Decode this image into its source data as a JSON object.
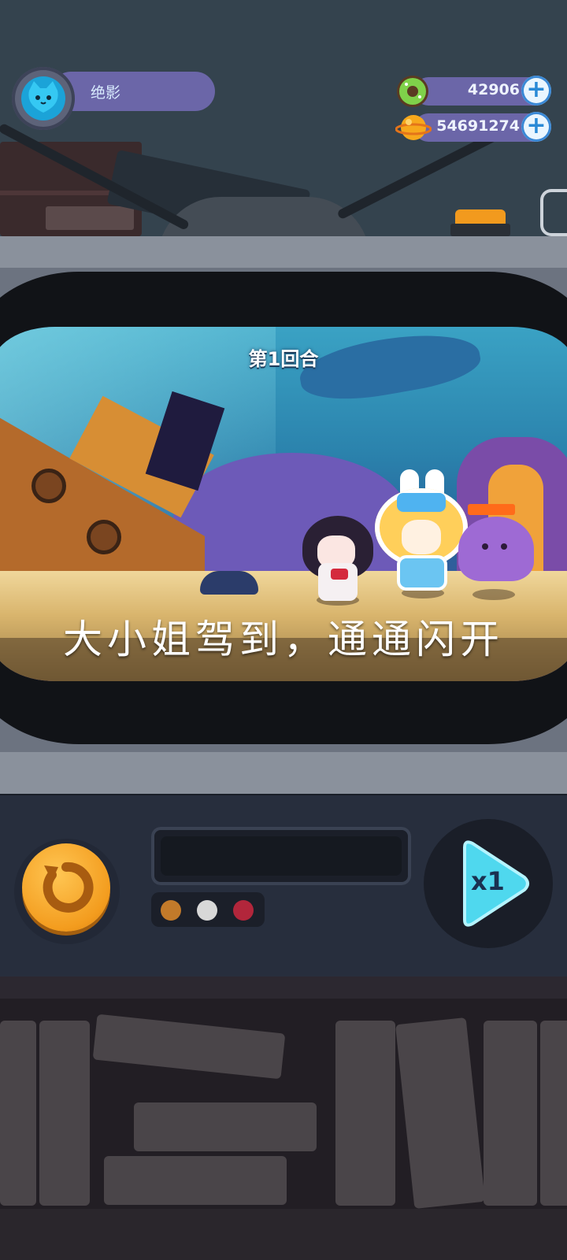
{
  "player": {
    "name": "绝影",
    "avatar": "cat-avatar"
  },
  "currencies": [
    {
      "name": "donut",
      "icon": "donut-icon",
      "value": "42906",
      "add": "+"
    },
    {
      "name": "planet",
      "icon": "planet-icon",
      "value": "54691274",
      "add": "+"
    }
  ],
  "battle": {
    "round": "第1回合",
    "subtitle": "大小姐驾到，通通闪开"
  },
  "controls": {
    "replay_icon": "replay-icon",
    "speed_label": "x1",
    "speed_icon": "play-icon"
  },
  "lamps": [
    "#c27a2a",
    "#d8d8d8",
    "#b2263b"
  ],
  "colors": {
    "accent": "#6b66a8",
    "gold": "#f39c1e",
    "cyan": "#4fd8ee"
  }
}
